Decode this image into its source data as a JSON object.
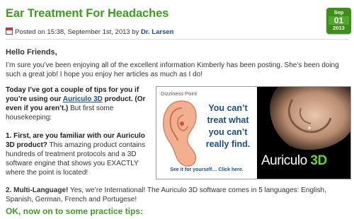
{
  "post": {
    "title": "Ear Treatment For Headaches",
    "date_badge": {
      "month": "Sep",
      "day": "01",
      "year": "2013"
    },
    "meta": {
      "posted_on": "Posted on 15:38, September 1st, 2013 by ",
      "author": "Dr. Larsen"
    },
    "greeting": "Hello Friends,",
    "intro": "I’m sure you’ve been enjoying all of the excellent information Kimberly has been posting. She’s been doing such a great job! I hope you enjoy her articles as much as I do!",
    "tips_intro": {
      "bold_a": "Today I’ve got a couple of tips for you if you’re using our ",
      "link": "Auriculo 3D",
      "bold_b": " product. (Or even if you aren’t.)",
      "tail": " But first some housekeeping:"
    },
    "item1": {
      "bold": "1. First, are you familiar with our Auriculo 3D product?",
      "text": " This amazing product contains hundreds of treatment protocols and a 3D software engine that shows you EXACTLY where the point is located!"
    },
    "item2": {
      "bold": "2. Multi-Language!",
      "text": " Yes, we’re International! The Auriculo 3D software comes in 5 languages: English, Spanish, German, French and Portugese!"
    },
    "practice": "OK, now on to some practice tips:",
    "ad": {
      "label": "Dizziness Point",
      "headline": "You can’t treat what you can’t really find.",
      "cta": "See it for yourself… Click here.",
      "brand_main": "Auriculo ",
      "brand_3d": "3D"
    }
  }
}
